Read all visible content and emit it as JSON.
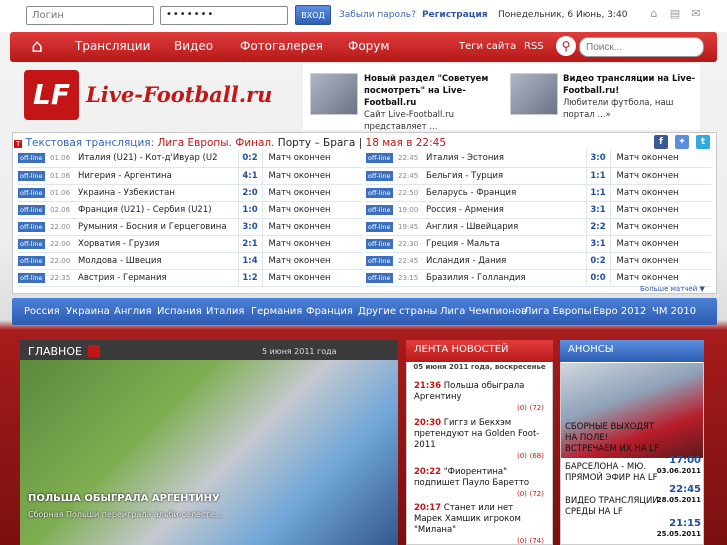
{
  "topbar": {
    "login_placeholder": "Логин",
    "password_value": "•••••••",
    "login_button": "ВХОД",
    "forgot": "Забыли пароль?",
    "register": "Регистрация",
    "date": "Понедельник, 6 Июнь, 3:40"
  },
  "nav": {
    "items": [
      "Трансляции",
      "Видео",
      "Фотогалерея",
      "Форум"
    ],
    "tags": "Теги сайта",
    "rss": "RSS",
    "search_placeholder": "Поиск..."
  },
  "logo": {
    "mark": "LF",
    "text": "Live-Football.ru"
  },
  "promo": [
    {
      "title": "Новый раздел \"Советуем посмотреть\" на Live-Football.ru",
      "text": "Сайт Live-Football.ru представляет ..."
    },
    {
      "title": "Видео трансляции на Live-Football.ru!",
      "text": "Любители футбола, наш портал ...»"
    }
  ],
  "live": {
    "label": "Текстовая трансляция:",
    "event": "Лига Европы. Финал.",
    "teams": "Порту – Брага",
    "date": "18 мая в 22:45",
    "more": "Больше матчей ▼",
    "status_tag": "off-line",
    "left": [
      {
        "time": "01.06",
        "teams": "Италия (U21) - Кот-д'Ивуар (U2",
        "score": "0:2",
        "status": "Матч окончен"
      },
      {
        "time": "01.06",
        "teams": "Нигерия - Аргентина",
        "score": "4:1",
        "status": "Матч окончен"
      },
      {
        "time": "01.06",
        "teams": "Украина - Узбекистан",
        "score": "2:0",
        "status": "Матч окончен"
      },
      {
        "time": "02.06",
        "teams": "Франция (U21) - Сербия (U21)",
        "score": "1:0",
        "status": "Матч окончен"
      },
      {
        "time": "22:00",
        "teams": "Румыния - Босния и Герцеговина",
        "score": "3:0",
        "status": "Матч окончен"
      },
      {
        "time": "22:00",
        "teams": "Хорватия - Грузия",
        "score": "2:1",
        "status": "Матч окончен"
      },
      {
        "time": "22:00",
        "teams": "Молдова - Швеция",
        "score": "1:4",
        "status": "Матч окончен"
      },
      {
        "time": "22:35",
        "teams": "Австрия - Германия",
        "score": "1:2",
        "status": "Матч окончен"
      }
    ],
    "right": [
      {
        "time": "22:45",
        "teams": "Италия - Эстония",
        "score": "3:0",
        "status": "Матч окончен"
      },
      {
        "time": "22:45",
        "teams": "Бельгия - Турция",
        "score": "1:1",
        "status": "Матч окончен"
      },
      {
        "time": "22:50",
        "teams": "Беларусь - Франция",
        "score": "1:1",
        "status": "Матч окончен"
      },
      {
        "time": "19:00",
        "teams": "Россия - Армения",
        "score": "3:1",
        "status": "Матч окончен"
      },
      {
        "time": "19:45",
        "teams": "Англия - Швейцария",
        "score": "2:2",
        "status": "Матч окончен"
      },
      {
        "time": "22:30",
        "teams": "Греция - Мальта",
        "score": "3:1",
        "status": "Матч окончен"
      },
      {
        "time": "22:45",
        "teams": "Исландия - Дания",
        "score": "0:2",
        "status": "Матч окончен"
      },
      {
        "time": "23:15",
        "teams": "Бразилия - Голландия",
        "score": "0:0",
        "status": "Матч окончен"
      }
    ]
  },
  "countries": [
    "Россия",
    "Украина",
    "Англия",
    "Испания",
    "Италия",
    "Германия",
    "Франция",
    "Другие страны",
    "Лига Чемпионов",
    "Лига Европы",
    "Евро 2012",
    "ЧМ 2010"
  ],
  "main": {
    "heading": "ГЛАВНОЕ",
    "date": "5 июня 2011 года",
    "subtitle": "ПОЛЬША ОБЫГРАЛА АРГЕНТИНУ",
    "description": "Сборная Польши переиграла альби-селесте..."
  },
  "news": {
    "heading": "ЛЕНТА НОВОСТЕЙ",
    "date": "05 июня 2011 года, воскресенье",
    "items": [
      {
        "time": "21:36",
        "title": "Польша обыграла Аргентину",
        "comments": "(0)",
        "views": "(72)"
      },
      {
        "time": "20:30",
        "title": "Гиггз и Бекхэм претендуют на Golden Foot-2011",
        "comments": "(0)",
        "views": "(68)"
      },
      {
        "time": "20:22",
        "title": "\"Фиорентина\" подпишет Пауло Баретто",
        "comments": "(0)",
        "views": "(72)"
      },
      {
        "time": "20:17",
        "title": "Станет или нет Марек Хамшик игроком \"Милана\"",
        "comments": "(0)",
        "views": "(74)"
      }
    ]
  },
  "anons": {
    "heading": "АНОНСЫ",
    "items": [
      {
        "title": "СБОРНЫЕ ВЫХОДЯТ НА ПОЛЕ! ВСТРЕЧАЕМ ИХ НА LF",
        "time": "17:00",
        "date": "03.06.2011"
      },
      {
        "title": "БАРСЕЛОНА - МЮ. ПРЯМОЙ ЭФИР НА LF",
        "time": "22:45",
        "date": "28.05.2011"
      },
      {
        "title": "ВИДЕО ТРАНСЛЯЦИИ СРЕДЫ НА LF",
        "time": "21:15",
        "date": "25.05.2011"
      }
    ]
  }
}
